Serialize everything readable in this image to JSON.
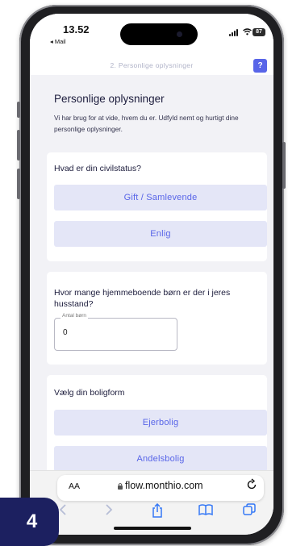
{
  "status_bar": {
    "time": "13.52",
    "back_app": "◂ Mail",
    "wifi_glyph": "wifi-icon",
    "battery": "87"
  },
  "header": {
    "step_label": "2. Personlige oplysninger",
    "help_label": "?"
  },
  "intro": {
    "title": "Personlige oplysninger",
    "text": "Vi har brug for at vide, hvem du er. Udfyld nemt og hurtigt dine personlige oplysninger."
  },
  "civil_status": {
    "question": "Hvad er din civilstatus?",
    "options": [
      "Gift / Samlevende",
      "Enlig"
    ]
  },
  "children": {
    "question": "Hvor mange hjemmeboende børn er der i jeres husstand?",
    "field_label": "Antal børn",
    "field_value": "0"
  },
  "housing": {
    "question": "Vælg din boligform",
    "options": [
      "Ejerbolig",
      "Andelsbolig"
    ]
  },
  "browser": {
    "text_size_label": "AA",
    "url": "flow.monthio.com"
  },
  "step_badge": "4",
  "colors": {
    "accent": "#5865e8",
    "option_bg": "#e4e6f7",
    "badge": "#1c2060",
    "page_bg": "#f2f2f6"
  }
}
